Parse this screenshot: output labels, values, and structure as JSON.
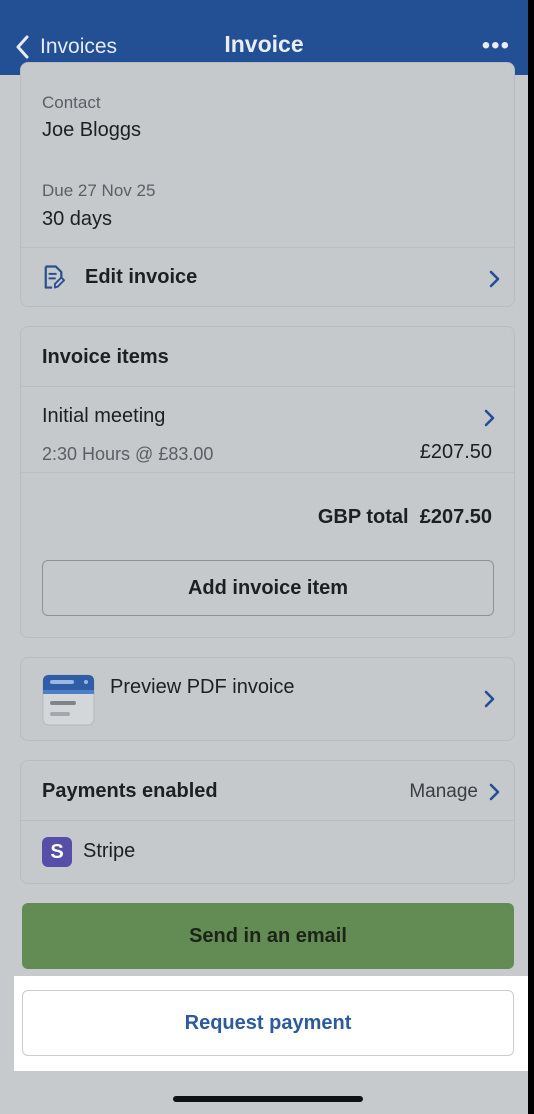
{
  "header": {
    "back_label": "Invoices",
    "title": "Invoice",
    "more_label": "•••"
  },
  "details": {
    "contact_label": "Contact",
    "contact_value": "Joe Bloggs",
    "due_label": "Due 27 Nov 25",
    "due_value": "30 days",
    "edit_label": "Edit invoice"
  },
  "items": {
    "heading": "Invoice items",
    "rows": [
      {
        "name": "Initial meeting",
        "detail": "2:30 Hours @ £83.00",
        "amount": "£207.50"
      }
    ],
    "total_label": "GBP total",
    "total_value": "£207.50",
    "add_label": "Add invoice item"
  },
  "preview": {
    "label": "Preview PDF invoice"
  },
  "payments": {
    "heading": "Payments enabled",
    "manage_label": "Manage",
    "provider_badge": "S",
    "provider_name": "Stripe"
  },
  "actions": {
    "send_label": "Send in an email",
    "request_label": "Request payment"
  },
  "colors": {
    "header_bg": "#234f94",
    "accent_link": "#234f94",
    "send_button": "#628c54",
    "stripe": "#554fa8"
  }
}
